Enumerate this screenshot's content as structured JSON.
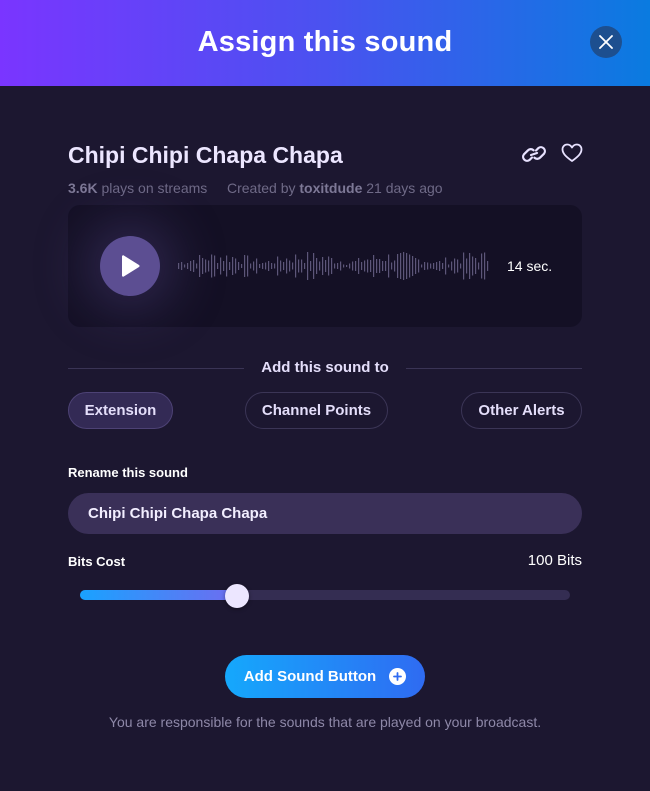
{
  "header": {
    "title": "Assign this sound",
    "close_icon": "close-icon"
  },
  "sound": {
    "title": "Chipi Chipi Chapa Chapa",
    "plays_count": "3.6K",
    "plays_suffix": "plays on streams",
    "created_prefix": "Created by",
    "creator": "toxitdude",
    "created_ago": "21 days ago",
    "link_icon": "link-icon",
    "favorite_icon": "heart-icon"
  },
  "player": {
    "play_icon": "play-icon",
    "duration": "14 sec."
  },
  "add_to": {
    "label": "Add this sound to",
    "options": [
      "Extension",
      "Channel Points",
      "Other Alerts"
    ],
    "selected": "Extension"
  },
  "rename": {
    "label": "Rename this sound",
    "value": "Chipi Chipi Chapa Chapa"
  },
  "bits": {
    "label": "Bits Cost",
    "value_text": "100 Bits",
    "slider_fraction": 0.32
  },
  "actions": {
    "add_button_label": "Add Sound Button",
    "add_icon": "plus-circle-icon"
  },
  "footer": {
    "disclaimer": "You are responsible for the sounds that are played on your broadcast."
  },
  "colors": {
    "header_gradient_start": "#7a35ff",
    "header_gradient_end": "#0a7be0",
    "background": "#1c1730",
    "accent": "#19a2ff"
  }
}
